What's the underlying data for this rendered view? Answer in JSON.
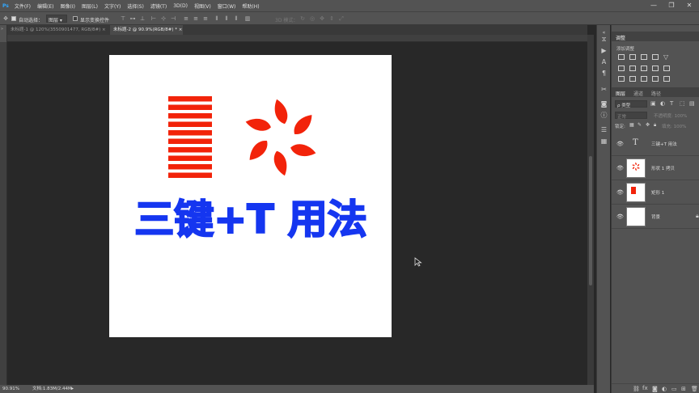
{
  "menu": {
    "items": [
      "文件(F)",
      "编辑(E)",
      "图像(I)",
      "图层(L)",
      "文字(Y)",
      "选择(S)",
      "滤镜(T)",
      "3D(D)",
      "视图(V)",
      "窗口(W)",
      "帮助(H)"
    ],
    "minimize": "—",
    "restore": "❐",
    "close": "✕"
  },
  "options": {
    "auto_select_label": "自动选择：",
    "auto_select_value": "图层",
    "show_transform_label": "显示变换控件",
    "mode_3d_label": "3D 模式："
  },
  "tabs": [
    {
      "label": "未标题-1 @ 120%(3550901477, RGB/8#) ×",
      "active": false
    },
    {
      "label": "未标题-2 @ 90.9%(RGB/8#) *  ×",
      "active": true
    }
  ],
  "canvas_art": {
    "headline": "三键+T 用法",
    "headline_color": "#1536f0",
    "shape_color": "#f2230a",
    "stripe_count": 10
  },
  "status": {
    "zoom": "90.91%",
    "doc_info": "文档:1.83M/2.44M"
  },
  "right": {
    "adjust_title": "调整",
    "adjust_subtitle": "添加调整",
    "layer_tabs": [
      "图层",
      "通道",
      "路径"
    ],
    "kind_label": "ρ 类型",
    "blend_mode": "正常",
    "opacity_label": "不透明度: 100%",
    "lock_label": "锁定:",
    "fill_label": "填充: 100%",
    "layers": [
      {
        "name": "三键+T 用法",
        "kind": "text",
        "icon": "T"
      },
      {
        "name": "形状 1 拷贝",
        "kind": "shape-flower"
      },
      {
        "name": "矩形 1",
        "kind": "shape-stripes"
      },
      {
        "name": "背景",
        "kind": "background"
      }
    ]
  }
}
